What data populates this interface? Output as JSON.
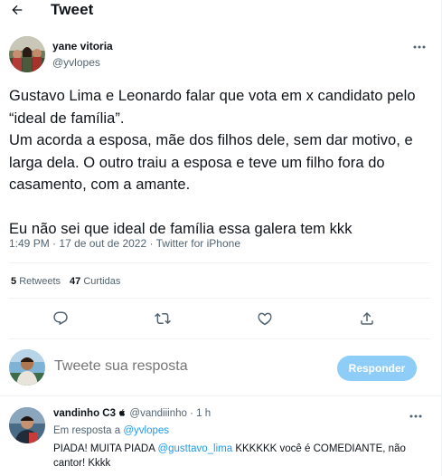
{
  "header": {
    "title": "Tweet",
    "back_icon": "arrow-left-icon"
  },
  "tweet": {
    "author": {
      "name": "yane vitoria",
      "handle": "@yvlopes"
    },
    "paragraphs": [
      "Gustavo Lima e Leonardo falar que vota em x candidato pelo “ideal de família”.\nUm acorda a esposa, mãe dos filhos dele, sem dar motivo, e larga dela. O outro traiu a esposa e teve um filho fora do casamento, com a amante.",
      "Eu não sei que ideal de família essa galera tem kkk"
    ],
    "time": "1:49 PM",
    "date": "17 de out de 2022",
    "separator": "·",
    "source": "Twitter for iPhone",
    "stats": {
      "retweets_count": "5",
      "retweets_label": "Retweets",
      "likes_count": "47",
      "likes_label": "Curtidas"
    }
  },
  "compose": {
    "placeholder": "Tweete sua resposta",
    "button_label": "Responder"
  },
  "reply": {
    "name": "vandinho C3",
    "handle": "@vandiiinho",
    "separator": "·",
    "time": "1 h",
    "replying_prefix": "Em resposta a",
    "replying_to": "@yvlopes",
    "text_start": "PIADA! MUITA PIADA",
    "text_mention": "@gusttavo_lima",
    "text_end": "KKKKKK você é COMEDIANTE, não cantor! Kkkk"
  },
  "colors": {
    "accent": "#1d9bf0",
    "text_secondary": "#536471",
    "button_disabled": "#8ecdf8"
  }
}
